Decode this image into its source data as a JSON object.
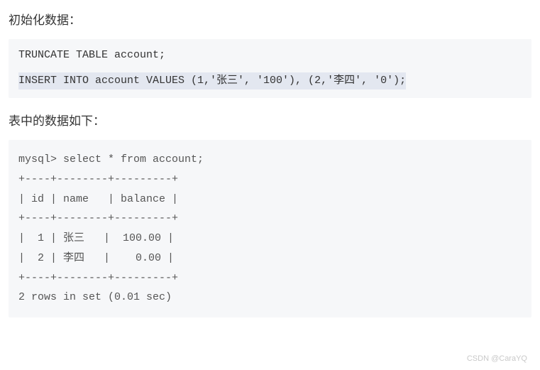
{
  "section1_title": "初始化数据：",
  "code1_line1": "TRUNCATE TABLE account;",
  "code1_line2": "INSERT INTO account VALUES (1,'张三', '100'), (2,'李四', '0');",
  "section2_title": "表中的数据如下：",
  "output_text": "mysql> select * from account;\n+----+--------+---------+\n| id | name   | balance |\n+----+--------+---------+\n|  1 | 张三   |  100.00 |\n|  2 | 李四   |    0.00 |\n+----+--------+---------+\n2 rows in set (0.01 sec)",
  "watermark": "CSDN @CaraYQ"
}
